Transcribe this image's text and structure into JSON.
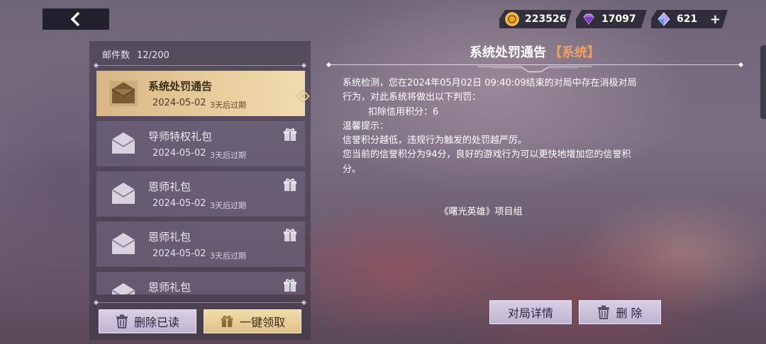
{
  "currencies": [
    {
      "icon": "gold-coin-icon",
      "value": "223526"
    },
    {
      "icon": "purple-diamond-icon",
      "value": "17097"
    },
    {
      "icon": "crystal-gem-icon",
      "value": "621"
    }
  ],
  "mailbox": {
    "count_label": "邮件数",
    "count_value": "12/200",
    "items": [
      {
        "title": "系统处罚通告",
        "date": "2024-05-02",
        "expire": "3天后过期",
        "has_gift": false
      },
      {
        "title": "导师特权礼包",
        "date": "2024-05-02",
        "expire": "3天后过期",
        "has_gift": true
      },
      {
        "title": "恩师礼包",
        "date": "2024-05-02",
        "expire": "3天后过期",
        "has_gift": true
      },
      {
        "title": "恩师礼包",
        "date": "2024-05-02",
        "expire": "3天后过期",
        "has_gift": true
      },
      {
        "title": "恩师礼包",
        "date": "",
        "expire": "",
        "has_gift": true
      }
    ],
    "delete_read_label": "删除已读",
    "claim_all_label": "一键领取"
  },
  "detail": {
    "title": "系统处罚通告",
    "tag": "【系统】",
    "lines": [
      "系统检测，您在2024年05月02日 09:40:09结束的对局中存在消极对局",
      "行为，对此系统将做出以下判罚：",
      "扣除信用积分：6",
      "温馨提示：",
      "信誉积分越低，违规行为触发的处罚越严厉。",
      "您当前的信誉积分为94分，良好的游戏行为可以更快地增加您的信誉积",
      "分。"
    ],
    "signature": "《曙光英雄》项目组",
    "match_detail_label": "对局详情",
    "delete_label": "删 除"
  }
}
